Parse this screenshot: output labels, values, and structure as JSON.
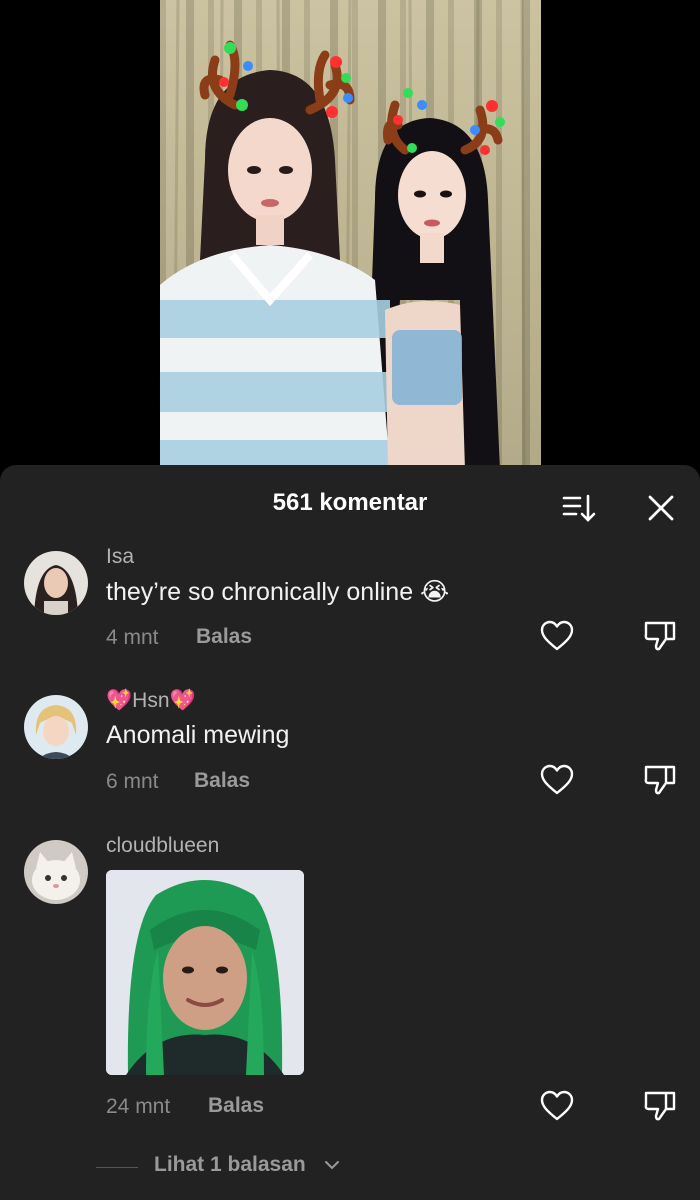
{
  "header": {
    "title": "561 komentar",
    "sort_icon": "sort-icon",
    "close_icon": "close-icon"
  },
  "comments": [
    {
      "username": "Isa",
      "text": "they’re so chronically online 😭",
      "time": "4 mnt",
      "reply_label": "Balas"
    },
    {
      "username": "💖Hsn💖",
      "text": "Anomali mewing",
      "time": "6 mnt",
      "reply_label": "Balas"
    },
    {
      "username": "cloudblueen",
      "text": "",
      "time": "24 mnt",
      "reply_label": "Balas",
      "has_image": true
    }
  ],
  "view_replies": {
    "label": "Lihat 1 balasan"
  },
  "colors": {
    "sheet_bg": "#222222",
    "username": "#b3b3b3",
    "meta": "#8a8a8a",
    "reply": "#9a9a9a"
  }
}
